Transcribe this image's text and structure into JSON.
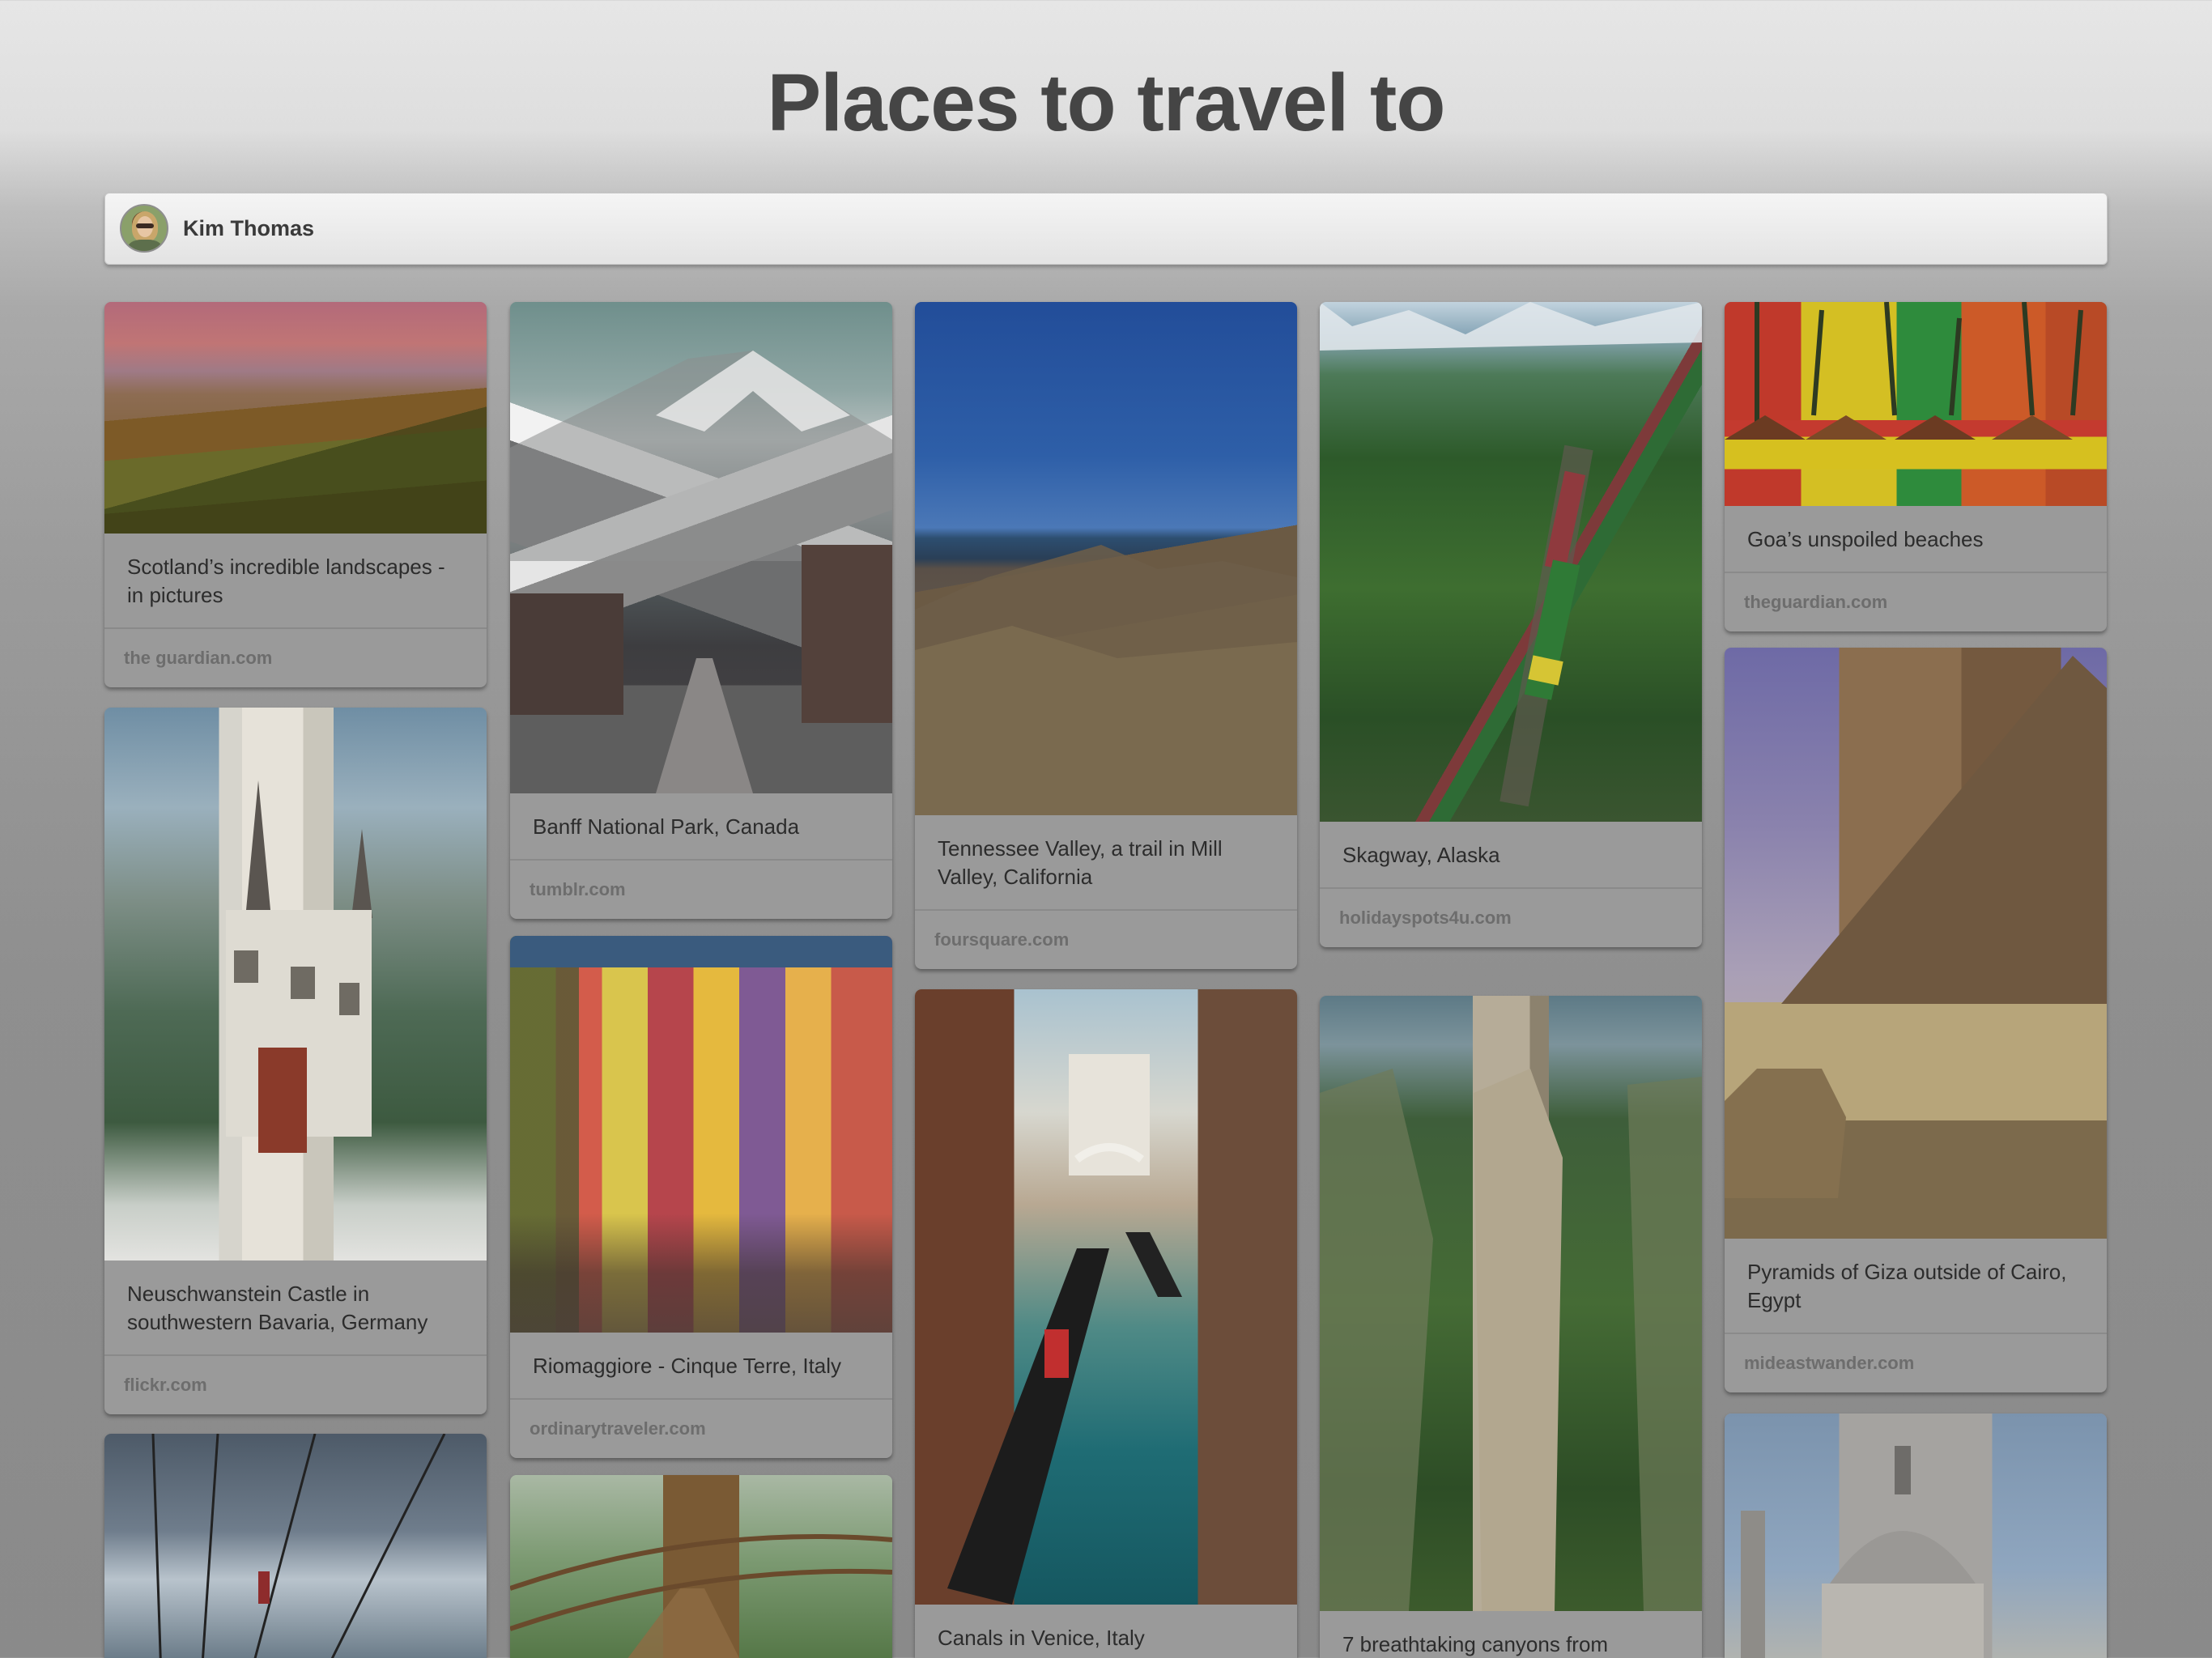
{
  "page": {
    "title": "Places to travel to"
  },
  "user": {
    "name": "Kim Thomas",
    "avatar_icon": "user-avatar"
  },
  "pins": [
    {
      "id": "scotland",
      "caption": "Scotland’s incredible landscapes - in pictures",
      "source": "the guardian.com"
    },
    {
      "id": "neuschwanstein",
      "caption": "Neuschwanstein Castle in southwestern Bavaria, Germany",
      "source": "flickr.com"
    },
    {
      "id": "zipline",
      "caption": "",
      "source": ""
    },
    {
      "id": "banff",
      "caption": "Banff National Park, Canada",
      "source": "tumblr.com"
    },
    {
      "id": "riomaggiore",
      "caption": "Riomaggiore - Cinque Terre, Italy",
      "source": "ordinarytraveler.com"
    },
    {
      "id": "bridge",
      "caption": "",
      "source": ""
    },
    {
      "id": "tennessee",
      "caption": "Tennessee Valley, a trail in Mill Valley, California",
      "source": "foursquare.com"
    },
    {
      "id": "venice",
      "caption": "Canals in Venice, Italy",
      "source": ""
    },
    {
      "id": "skagway",
      "caption": "Skagway, Alaska",
      "source": "holidayspots4u.com"
    },
    {
      "id": "canyons",
      "caption": "7 breathtaking canyons from",
      "source": ""
    },
    {
      "id": "goa",
      "caption": "Goa’s unspoiled beaches",
      "source": "theguardian.com"
    },
    {
      "id": "giza",
      "caption": "Pyramids of Giza outside of Cairo, Egypt",
      "source": "mideastwander.com"
    },
    {
      "id": "dome",
      "caption": "",
      "source": ""
    }
  ]
}
